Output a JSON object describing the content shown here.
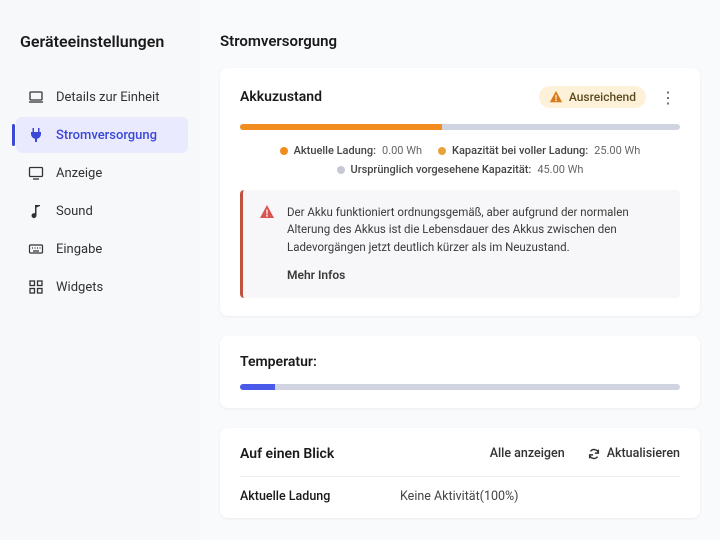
{
  "sidebar": {
    "title": "Geräteeinstellungen",
    "items": [
      {
        "label": "Details zur Einheit",
        "icon": "laptop"
      },
      {
        "label": "Stromversorgung",
        "icon": "plug"
      },
      {
        "label": "Anzeige",
        "icon": "monitor"
      },
      {
        "label": "Sound",
        "icon": "note"
      },
      {
        "label": "Eingabe",
        "icon": "keyboard"
      },
      {
        "label": "Widgets",
        "icon": "widgets"
      }
    ],
    "activeIndex": 1
  },
  "page": {
    "title": "Stromversorgung"
  },
  "battery": {
    "title": "Akkuzustand",
    "badge": "Ausreichend",
    "fill_percent": 46,
    "legend": {
      "current_label": "Aktuelle Ladung:",
      "current_value": "0.00 Wh",
      "full_label": "Kapazität bei voller Ladung:",
      "full_value": "25.00 Wh",
      "design_label": "Ursprünglich vorgesehene Kapazität:",
      "design_value": "45.00 Wh"
    },
    "alert": {
      "text": "Der Akku funktioniert ordnungsgemäß, aber aufgrund der normalen Alterung des Akkus ist die Lebensdauer des Akkus zwischen den Ladevorgängen jetzt deutlich kürzer als im Neuzustand.",
      "more": "Mehr Infos"
    }
  },
  "temperature": {
    "title": "Temperatur:",
    "fill_percent": 8
  },
  "glance": {
    "title": "Auf einen Blick",
    "show_all": "Alle anzeigen",
    "refresh": "Aktualisieren",
    "rows": [
      {
        "key": "Aktuelle Ladung",
        "value": "Keine Aktivität(100%)"
      }
    ]
  },
  "colors": {
    "orange": "#f28c1e",
    "amber": "#e7a33a",
    "grey": "#c5c9d6",
    "blue": "#4a5ae8"
  }
}
